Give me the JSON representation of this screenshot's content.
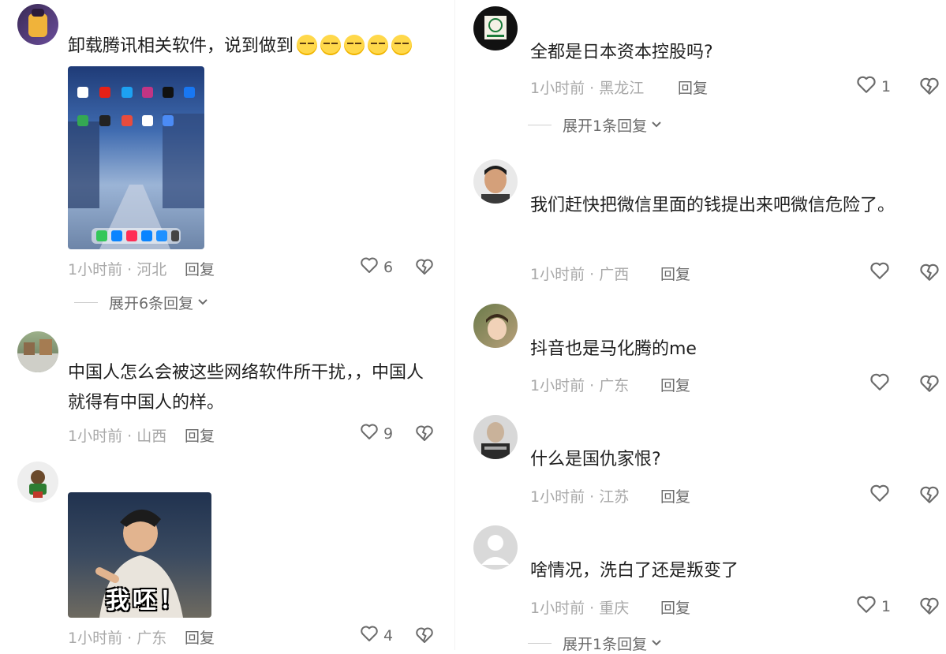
{
  "left_comments": [
    {
      "text": "卸载腾讯相关软件，说到做到",
      "emoji_count": 5,
      "meta": "1小时前 · 河北",
      "reply_label": "回复",
      "likes": "6",
      "expand_label": "展开6条回复"
    },
    {
      "text": "中国人怎么会被这些网络软件所干扰，，中国人就得有中国人的样。",
      "meta": "1小时前 · 山西",
      "reply_label": "回复",
      "likes": "9"
    },
    {
      "sticker_text": "我呸！",
      "meta": "1小时前 · 广东",
      "reply_label": "回复",
      "likes": "4"
    }
  ],
  "right_comments": [
    {
      "text": "全都是日本资本控股吗?",
      "meta": "1小时前 · 黑龙江",
      "reply_label": "回复",
      "likes": "1",
      "expand_label": "展开1条回复"
    },
    {
      "text": "我们赶快把微信里面的钱提出来吧微信危险了。",
      "meta": "1小时前 · 广西",
      "reply_label": "回复",
      "likes": ""
    },
    {
      "text": "抖音也是马化腾的me",
      "meta": "1小时前 · 广东",
      "reply_label": "回复",
      "likes": ""
    },
    {
      "text": "什么是国仇家恨?",
      "meta": "1小时前 · 江苏",
      "reply_label": "回复",
      "likes": ""
    },
    {
      "text": "啥情况，洗白了还是叛变了",
      "meta": "1小时前 · 重庆",
      "reply_label": "回复",
      "likes": "1",
      "expand_label": "展开1条回复"
    }
  ],
  "colors": {
    "meta": "#a8a8a8",
    "action": "#6b6b6b",
    "text": "#1f1f1f"
  },
  "icons": [
    "heart-icon",
    "heart-broken-icon",
    "chevron-down-icon"
  ]
}
